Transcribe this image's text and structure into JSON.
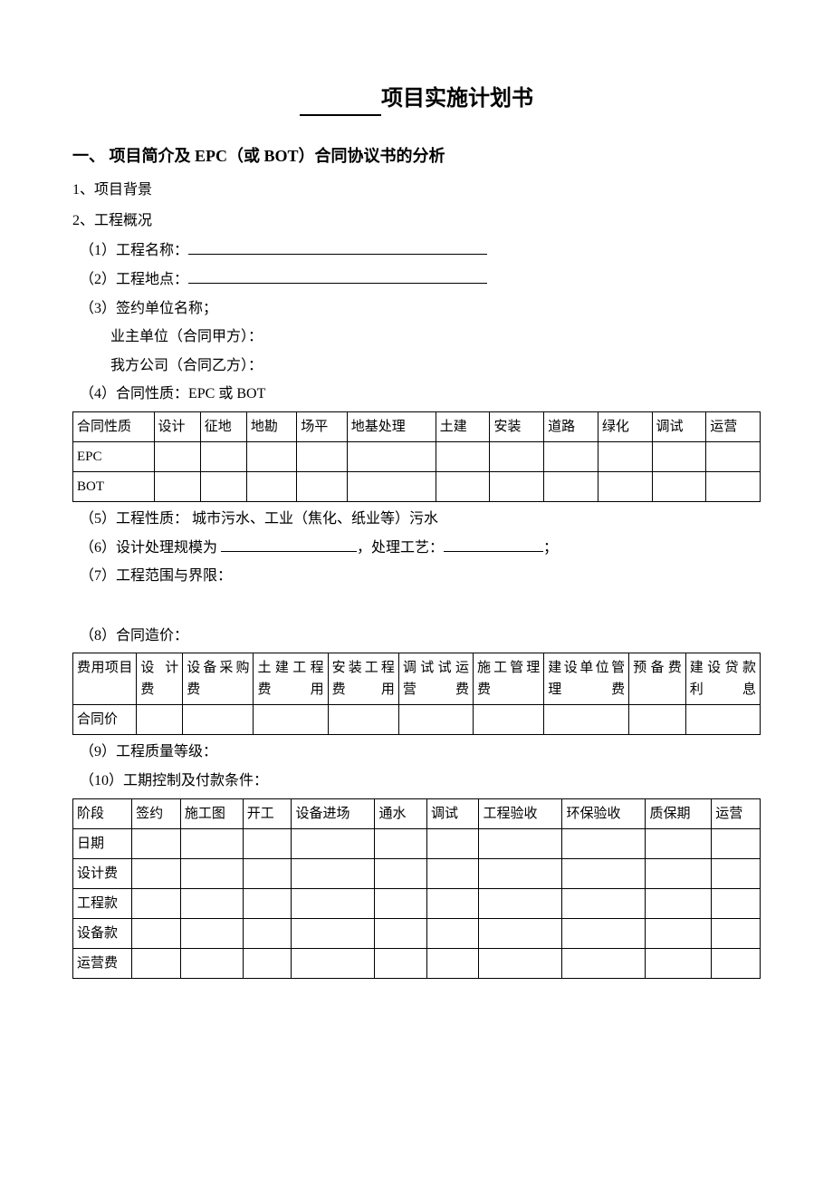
{
  "title_suffix": "项目实施计划书",
  "section1_heading": "一、 项目简介及 EPC（或 BOT）合同协议书的分析",
  "items": {
    "i1": "1、项目背景",
    "i2": "2、工程概况",
    "s1": "（1）工程名称：",
    "s2": "（2）工程地点：",
    "s3": "（3）签约单位名称；",
    "s3a": "业主单位（合同甲方）：",
    "s3b": "我方公司（合同乙方）：",
    "s4": "（4）合同性质：EPC 或 BOT",
    "s5": "（5）工程性质：  城市污水、工业（焦化、纸业等）污水",
    "s6a": "（6）设计处理规模为 ",
    "s6b": "，处理工艺：",
    "s6c": "；",
    "s7": "（7）工程范围与界限：",
    "s8": "（8）合同造价：",
    "s9": "（9）工程质量等级：",
    "s10": "（10）工期控制及付款条件："
  },
  "table1": {
    "headers": [
      "合同性质",
      "设计",
      "征地",
      "地勘",
      "场平",
      "地基处理",
      "土建",
      "安装",
      "道路",
      "绿化",
      "调试",
      "运营"
    ],
    "rows": [
      [
        "EPC",
        "",
        "",
        "",
        "",
        "",
        "",
        "",
        "",
        "",
        "",
        ""
      ],
      [
        "BOT",
        "",
        "",
        "",
        "",
        "",
        "",
        "",
        "",
        "",
        "",
        ""
      ]
    ]
  },
  "table2": {
    "headers": [
      "费用项目",
      "设计费",
      "设备采购费",
      "土建工程费用",
      "安装工程费用",
      "调试试运营费",
      "施工管理费",
      "建设单位管理费",
      "预备费",
      "建设贷款利息"
    ],
    "rows": [
      [
        "合同价",
        "",
        "",
        "",
        "",
        "",
        "",
        "",
        "",
        ""
      ]
    ]
  },
  "table3": {
    "headers": [
      "阶段",
      "签约",
      "施工图",
      "开工",
      "设备进场",
      "通水",
      "调试",
      "工程验收",
      "环保验收",
      "质保期",
      "运营"
    ],
    "rows": [
      [
        "日期",
        "",
        "",
        "",
        "",
        "",
        "",
        "",
        "",
        "",
        ""
      ],
      [
        "设计费",
        "",
        "",
        "",
        "",
        "",
        "",
        "",
        "",
        "",
        ""
      ],
      [
        "工程款",
        "",
        "",
        "",
        "",
        "",
        "",
        "",
        "",
        "",
        ""
      ],
      [
        "设备款",
        "",
        "",
        "",
        "",
        "",
        "",
        "",
        "",
        "",
        ""
      ],
      [
        "运营费",
        "",
        "",
        "",
        "",
        "",
        "",
        "",
        "",
        "",
        ""
      ]
    ]
  }
}
